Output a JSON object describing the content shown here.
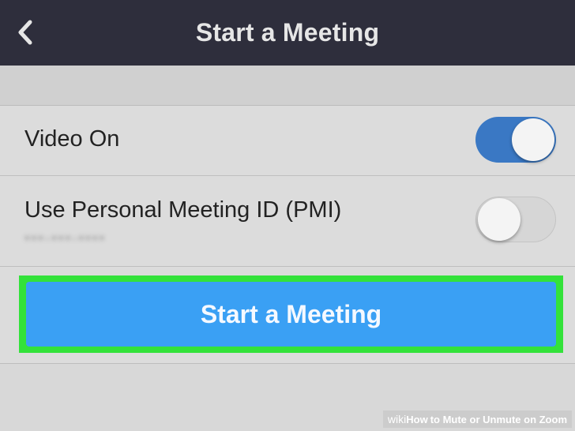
{
  "header": {
    "title": "Start a Meeting",
    "back_icon": "chevron-left-icon"
  },
  "settings": {
    "video": {
      "label": "Video On",
      "enabled": true
    },
    "pmi": {
      "label": "Use Personal Meeting ID (PMI)",
      "value": "•••-•••-••••",
      "enabled": false
    }
  },
  "actions": {
    "start_label": "Start a Meeting"
  },
  "watermark": {
    "wiki": "wiki",
    "how": "How",
    "rest": "to Mute or Unmute on Zoom"
  },
  "colors": {
    "header_bg": "#2e2e3c",
    "toggle_on": "#3a78c4",
    "primary_button": "#3aa0f4",
    "highlight": "#33e23a"
  }
}
